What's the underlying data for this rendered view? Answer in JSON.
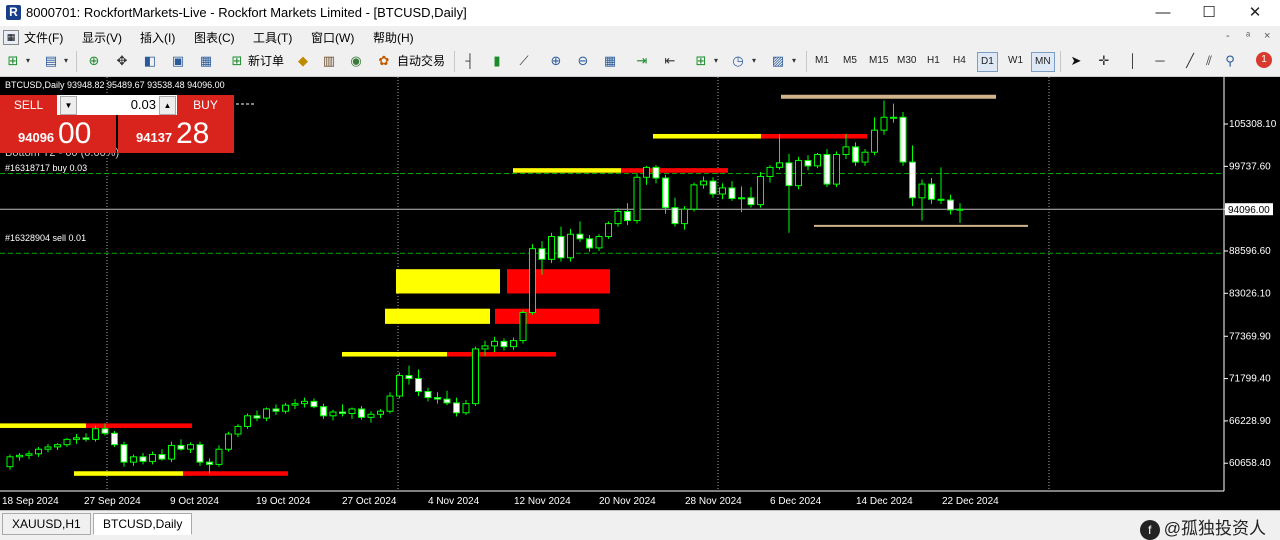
{
  "window": {
    "title": "8000701: RockfortMarkets-Live - Rockfort Markets Limited - [BTCUSD,Daily]",
    "logo_letter": "R",
    "controls": [
      "—",
      "☐",
      "✕"
    ]
  },
  "menu": {
    "items": [
      "文件(F)",
      "显示(V)",
      "插入(I)",
      "图表(C)",
      "工具(T)",
      "窗口(W)",
      "帮助(H)"
    ],
    "mdi_controls": [
      "-",
      "ᵃ",
      "×"
    ]
  },
  "toolbar": {
    "new_order_label": "新订单",
    "auto_trade_label": "自动交易",
    "timeframes": [
      "M1",
      "M5",
      "M15",
      "M30",
      "H1",
      "H4",
      "D1",
      "W1",
      "MN"
    ],
    "active_timeframe": "D1",
    "notification_count": "1"
  },
  "chart": {
    "header": "BTCUSD,Daily  93948.82 95489.67 93538.48 94096.00",
    "overlay_partial_text": "Bottom T2 - 00 (0.00%)",
    "orders": [
      "#16318717 buy 0.03",
      "#16328904 sell 0.01"
    ],
    "current_price_label": "94096.00",
    "colors": {
      "background": "#000000",
      "bull": "#00ff00",
      "bear_body": "#ffffff",
      "zone_yellow": "#ffff00",
      "zone_red": "#ff0000",
      "line_tan": "#d2b48c",
      "grid": "#aaaaaa",
      "order_line": "#00aa00"
    }
  },
  "trade_panel": {
    "sell_label": "SELL",
    "buy_label": "BUY",
    "lot": "0.03",
    "sell_price_prefix": "94096",
    "sell_price_main": "00",
    "buy_price_prefix": "94137",
    "buy_price_main": "28"
  },
  "chart_data": {
    "type": "candlestick",
    "symbol": "BTCUSD",
    "timeframe": "Daily",
    "ylim": [
      57000,
      111500
    ],
    "y_ticks": [
      "105308.10",
      "99737.60",
      "94096.00",
      "88596.60",
      "83026.10",
      "77369.90",
      "71799.40",
      "66228.90",
      "60658.40"
    ],
    "x_ticks": [
      "18 Sep 2024",
      "27 Sep 2024",
      "9 Oct 2024",
      "19 Oct 2024",
      "27 Oct 2024",
      "4 Nov 2024",
      "12 Nov 2024",
      "20 Nov 2024",
      "28 Nov 2024",
      "6 Dec 2024",
      "14 Dec 2024",
      "22 Dec 2024"
    ],
    "candles": [
      [
        60200,
        61800,
        59800,
        61500
      ],
      [
        61500,
        62000,
        61000,
        61700
      ],
      [
        61700,
        62300,
        61200,
        61900
      ],
      [
        61900,
        62800,
        61500,
        62500
      ],
      [
        62500,
        63200,
        62100,
        62800
      ],
      [
        62800,
        63300,
        62400,
        63100
      ],
      [
        63100,
        64000,
        62800,
        63800
      ],
      [
        63800,
        64500,
        63200,
        64000
      ],
      [
        64000,
        64600,
        63500,
        63800
      ],
      [
        63800,
        65600,
        63500,
        65200
      ],
      [
        65200,
        65900,
        64300,
        64600
      ],
      [
        64600,
        64900,
        62800,
        63100
      ],
      [
        63100,
        63500,
        60200,
        60800
      ],
      [
        60800,
        61800,
        60300,
        61500
      ],
      [
        61500,
        62000,
        60500,
        60900
      ],
      [
        60900,
        62200,
        60500,
        61800
      ],
      [
        61800,
        62500,
        61000,
        61200
      ],
      [
        61200,
        63500,
        60800,
        63000
      ],
      [
        63000,
        63800,
        62300,
        62500
      ],
      [
        62500,
        63400,
        62000,
        63100
      ],
      [
        63100,
        63500,
        60300,
        60800
      ],
      [
        60800,
        61300,
        59300,
        60500
      ],
      [
        60500,
        63000,
        60200,
        62500
      ],
      [
        62500,
        64800,
        62200,
        64500
      ],
      [
        64500,
        65800,
        64100,
        65500
      ],
      [
        65500,
        67200,
        65200,
        66900
      ],
      [
        66900,
        67600,
        66200,
        66600
      ],
      [
        66600,
        68000,
        66200,
        67800
      ],
      [
        67800,
        68400,
        67000,
        67500
      ],
      [
        67500,
        68600,
        67200,
        68300
      ],
      [
        68300,
        69100,
        67800,
        68500
      ],
      [
        68500,
        69300,
        68000,
        68800
      ],
      [
        68800,
        69200,
        67900,
        68100
      ],
      [
        68100,
        68500,
        66500,
        66900
      ],
      [
        66900,
        67700,
        66300,
        67400
      ],
      [
        67400,
        68400,
        66800,
        67200
      ],
      [
        67200,
        68000,
        66500,
        67800
      ],
      [
        67800,
        68200,
        66400,
        66700
      ],
      [
        66700,
        67500,
        66000,
        67100
      ],
      [
        67100,
        67800,
        66600,
        67500
      ],
      [
        67500,
        70000,
        67200,
        69500
      ],
      [
        69500,
        72600,
        69200,
        72200
      ],
      [
        72200,
        73500,
        71000,
        71800
      ],
      [
        71800,
        73000,
        69500,
        70100
      ],
      [
        70100,
        70600,
        68800,
        69300
      ],
      [
        69300,
        70000,
        68500,
        69100
      ],
      [
        69100,
        70200,
        68300,
        68600
      ],
      [
        68600,
        69300,
        66800,
        67300
      ],
      [
        67300,
        69000,
        67000,
        68500
      ],
      [
        68500,
        76000,
        68200,
        75700
      ],
      [
        75700,
        76800,
        74800,
        76100
      ],
      [
        76100,
        77300,
        75300,
        76700
      ],
      [
        76700,
        77100,
        75500,
        76000
      ],
      [
        76000,
        77200,
        75600,
        76800
      ],
      [
        76800,
        80800,
        76400,
        80500
      ],
      [
        80500,
        89500,
        80200,
        88900
      ],
      [
        88900,
        89900,
        85500,
        87500
      ],
      [
        87500,
        91000,
        87000,
        90500
      ],
      [
        90500,
        91800,
        87200,
        87700
      ],
      [
        87700,
        91500,
        87200,
        90800
      ],
      [
        90800,
        92500,
        89800,
        90200
      ],
      [
        90200,
        90700,
        88500,
        89000
      ],
      [
        89000,
        90800,
        88600,
        90500
      ],
      [
        90500,
        92500,
        90200,
        92200
      ],
      [
        92200,
        94200,
        91800,
        93800
      ],
      [
        93800,
        94900,
        92000,
        92600
      ],
      [
        92600,
        98800,
        92200,
        98300
      ],
      [
        98300,
        99800,
        97300,
        99600
      ],
      [
        99600,
        99900,
        97500,
        98200
      ],
      [
        98200,
        98600,
        93500,
        94300
      ],
      [
        94300,
        95600,
        91800,
        92200
      ],
      [
        92200,
        94500,
        91400,
        94100
      ],
      [
        94100,
        97600,
        93800,
        97300
      ],
      [
        97300,
        98400,
        96800,
        97800
      ],
      [
        97800,
        98300,
        95600,
        96100
      ],
      [
        96100,
        97500,
        95400,
        96900
      ],
      [
        96900,
        97800,
        95200,
        95500
      ],
      [
        95500,
        97100,
        93700,
        95600
      ],
      [
        95600,
        97000,
        94300,
        94700
      ],
      [
        94700,
        99000,
        94300,
        98400
      ],
      [
        98400,
        99900,
        97600,
        99600
      ],
      [
        99600,
        104000,
        99300,
        100200
      ],
      [
        100200,
        101400,
        91000,
        97200
      ],
      [
        97200,
        101000,
        96700,
        100500
      ],
      [
        100500,
        101200,
        99200,
        99800
      ],
      [
        99800,
        101500,
        99500,
        101300
      ],
      [
        101300,
        102000,
        97000,
        97400
      ],
      [
        97400,
        101700,
        97000,
        101300
      ],
      [
        101300,
        104000,
        100700,
        102300
      ],
      [
        102300,
        102900,
        99800,
        100300
      ],
      [
        100300,
        102000,
        99800,
        101600
      ],
      [
        101600,
        106200,
        101200,
        104500
      ],
      [
        104500,
        108400,
        103900,
        106200
      ],
      [
        106200,
        108000,
        105500,
        106200
      ],
      [
        106200,
        106900,
        99800,
        100300
      ],
      [
        100300,
        102500,
        94500,
        95600
      ],
      [
        95600,
        98000,
        92600,
        97400
      ],
      [
        97400,
        98200,
        94800,
        95400
      ],
      [
        95400,
        99600,
        94800,
        95300
      ],
      [
        95300,
        96000,
        93400,
        94000
      ],
      [
        94000,
        94900,
        92300,
        94100
      ]
    ],
    "zones": [
      {
        "color": "yellow",
        "y_low": 83000,
        "y_high": 86200
      },
      {
        "color": "red",
        "y_low": 83000,
        "y_high": 86200
      },
      {
        "color": "yellow",
        "y_low": 79000,
        "y_high": 81000
      },
      {
        "color": "red",
        "y_low": 79000,
        "y_high": 81000
      },
      {
        "color": "yellow",
        "y_low": 74700,
        "y_high": 75300
      },
      {
        "color": "red",
        "y_low": 74700,
        "y_high": 75300
      },
      {
        "color": "yellow",
        "y_low": 98900,
        "y_high": 99500
      },
      {
        "color": "red",
        "y_low": 98900,
        "y_high": 99500
      },
      {
        "color": "yellow",
        "y_low": 103400,
        "y_high": 104000
      },
      {
        "color": "red",
        "y_low": 103400,
        "y_high": 104000
      },
      {
        "color": "yellow",
        "y_low": 65300,
        "y_high": 65900
      },
      {
        "color": "red",
        "y_low": 65300,
        "y_high": 65900
      },
      {
        "color": "yellow",
        "y_low": 59000,
        "y_high": 59600
      },
      {
        "color": "red",
        "y_low": 59000,
        "y_high": 59600
      }
    ],
    "levels": [
      {
        "price": 108900,
        "color": "tan"
      },
      {
        "price": 91900,
        "color": "tan"
      }
    ],
    "order_levels": [
      {
        "label": "#16318717 buy 0.03",
        "price": 98800
      },
      {
        "label": "#16328904 sell 0.01",
        "price": 88300
      }
    ],
    "current_price": 94096.0
  },
  "tabs": [
    {
      "label": "XAUUSD,H1",
      "active": false
    },
    {
      "label": "BTCUSD,Daily",
      "active": true
    }
  ],
  "watermark": {
    "icon_letter": "f",
    "text": "@孤独投资人"
  }
}
